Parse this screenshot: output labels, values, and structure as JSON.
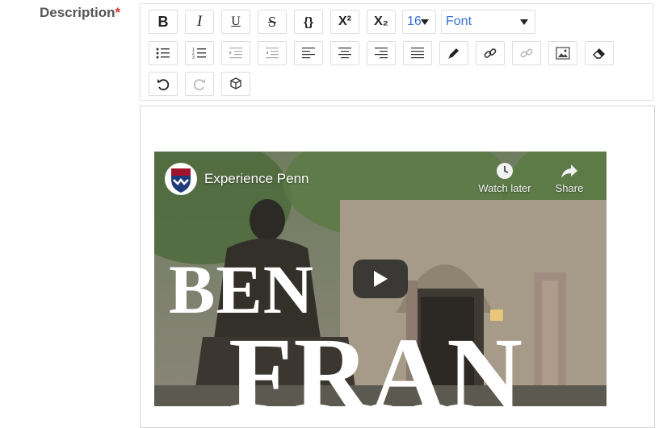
{
  "field": {
    "label": "Description",
    "required_mark": "*"
  },
  "toolbar": {
    "font_size": "16",
    "font_family": "Font",
    "rows": [
      [
        {
          "name": "bold-button",
          "icon": "bold-icon",
          "glyph": "B"
        },
        {
          "name": "italic-button",
          "icon": "italic-icon",
          "glyph": "I"
        },
        {
          "name": "underline-button",
          "icon": "underline-icon",
          "glyph": "U"
        },
        {
          "name": "strikethrough-button",
          "icon": "strikethrough-icon",
          "glyph": "S"
        },
        {
          "name": "code-button",
          "icon": "code-braces-icon",
          "glyph": "{}"
        },
        {
          "name": "superscript-button",
          "icon": "superscript-icon",
          "glyph": "X²"
        },
        {
          "name": "subscript-button",
          "icon": "subscript-icon",
          "glyph": "X₂"
        }
      ],
      [
        {
          "name": "bulleted-list-button",
          "icon": "bulleted-list-icon"
        },
        {
          "name": "numbered-list-button",
          "icon": "numbered-list-icon"
        },
        {
          "name": "indent-button",
          "icon": "indent-icon"
        },
        {
          "name": "outdent-button",
          "icon": "outdent-icon"
        },
        {
          "name": "align-left-button",
          "icon": "align-left-icon"
        },
        {
          "name": "align-center-button",
          "icon": "align-center-icon"
        },
        {
          "name": "align-right-button",
          "icon": "align-right-icon"
        },
        {
          "name": "justify-button",
          "icon": "justify-icon"
        },
        {
          "name": "text-color-button",
          "icon": "pen-icon"
        },
        {
          "name": "insert-link-button",
          "icon": "link-icon"
        },
        {
          "name": "remove-link-button",
          "icon": "unlink-icon"
        },
        {
          "name": "insert-image-button",
          "icon": "image-icon"
        },
        {
          "name": "clear-formatting-button",
          "icon": "eraser-icon"
        }
      ],
      [
        {
          "name": "undo-button",
          "icon": "undo-icon"
        },
        {
          "name": "redo-button",
          "icon": "redo-icon"
        },
        {
          "name": "embed-button",
          "icon": "cube-icon"
        }
      ]
    ]
  },
  "video": {
    "title": "Experience Penn",
    "watch_later_label": "Watch later",
    "share_label": "Share",
    "overlay_word_1": "BEN",
    "overlay_word_2": "FRAN",
    "icons": [
      "penn-shield-icon",
      "clock-icon",
      "share-arrow-icon",
      "play-icon"
    ]
  },
  "colors": {
    "label_text": "#555555",
    "required": "#e0312f",
    "select_text": "#3a6fd0",
    "play_button_bg": "#212121"
  }
}
